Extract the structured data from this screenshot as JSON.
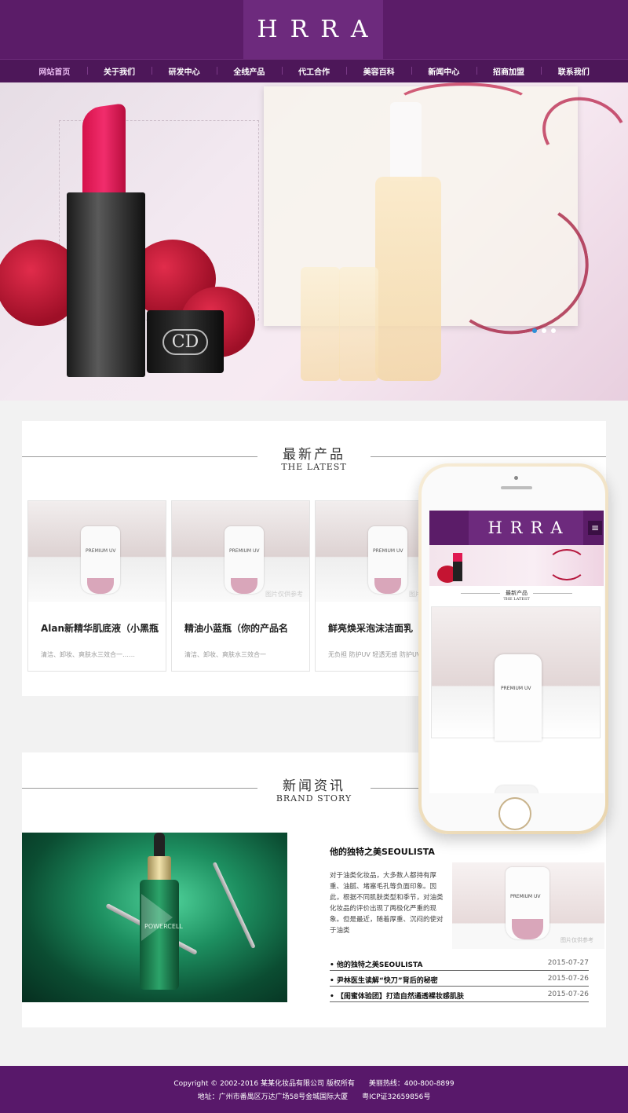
{
  "brand": {
    "logo": "HRRA",
    "accent": "#5b1c68"
  },
  "nav": {
    "items": [
      {
        "label": "网站首页",
        "active": true
      },
      {
        "label": "关于我们",
        "active": false
      },
      {
        "label": "研发中心",
        "active": false
      },
      {
        "label": "全线产品",
        "active": false
      },
      {
        "label": "代工合作",
        "active": false
      },
      {
        "label": "美容百科",
        "active": false
      },
      {
        "label": "新闻中心",
        "active": false
      },
      {
        "label": "招商加盟",
        "active": false
      },
      {
        "label": "联系我们",
        "active": false
      }
    ]
  },
  "banner": {
    "lipstick_cap_text": "CD",
    "slides_count": 3,
    "active_slide": 1
  },
  "products": {
    "title_cn": "最新产品",
    "title_en": "THE LATEST",
    "image_watermark": "图片仅供参考",
    "bottle_label": "PREMIUM UV",
    "items": [
      {
        "name": "Alan新精华肌底液（小黑瓶",
        "desc": "清洁、卸妆、爽肤水三效合一……"
      },
      {
        "name": "精油小蓝瓶（你的产品名",
        "desc": "清洁、卸妆、爽肤水三效合一"
      },
      {
        "name": "鲜亮焕采泡沫洁面乳",
        "desc": "无负担 防护UV 轻透无感 防护UV 肌……"
      }
    ]
  },
  "phone": {
    "logo": "HRRA",
    "menu_icon": "≡",
    "section_title_cn": "最新产品",
    "section_title_en": "THE LATEST",
    "bottle_label": "PREMIUM UV"
  },
  "news": {
    "title_cn": "新闻资讯",
    "title_en": "BRAND STORY",
    "image_label": "POWERCELL",
    "featured_title": "他的独特之美SEOULISTA",
    "featured_body": "对于油类化妆品，大多数人都持有厚重、油腻、堵塞毛孔等负面印象。因此，根据不同肌肤类型和季节，对油类化妆品的评价出现了两极化严重的现象。但是最近，随着厚重、沉闷的使对于油类",
    "thumb_label": "PREMIUM UV",
    "thumb_watermark": "图片仅供参考",
    "items": [
      {
        "title": "• 他的独特之美SEOULISTA",
        "date": "2015-07-27"
      },
      {
        "title": "• 尹林医生读解“快刀”背后的秘密",
        "date": "2015-07-26"
      },
      {
        "title": "• 【闺蜜体验团】打造自然通透裸妆感肌肤",
        "date": "2015-07-26"
      }
    ]
  },
  "footer": {
    "copyright": "Copyright © 2002-2016 某某化妆品有限公司 版权所有",
    "hotline": "美丽热线：400-800-8899",
    "address": "地址：广州市番禺区万达广场58号金城国际大厦",
    "icp": "粤ICP证32659856号"
  }
}
